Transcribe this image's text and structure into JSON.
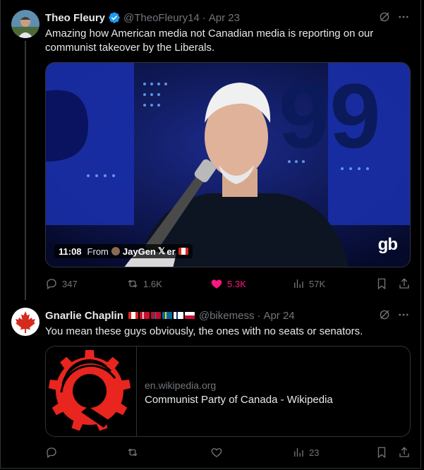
{
  "tweets": [
    {
      "author_name": "Theo Fleury",
      "verified": true,
      "handle": "@TheoFleury14",
      "separator": "·",
      "date": "Apr 23",
      "text_line1": "Amazing how American media not Canadian media  is reporting on our",
      "text_line2": "communist takeover by the Liberals.",
      "video": {
        "duration": "11:08",
        "from_label": "From",
        "source_name": "JayGen",
        "source_suffix": "er",
        "watermark": "gb"
      },
      "actions": {
        "replies": "347",
        "reposts": "1.6K",
        "likes": "5.3K",
        "views": "57K"
      },
      "like_color": "#f91880"
    },
    {
      "author_name": "Gnarlie Chaplin",
      "handle": "@bikemess",
      "separator": "·",
      "date": "Apr 24",
      "flags": [
        "canada",
        "denmark",
        "norway",
        "sweden",
        "finland",
        "greenland"
      ],
      "text": "You mean these guys obviously, the ones with no seats or senators.",
      "link_card": {
        "domain": "en.wikipedia.org",
        "title": "Communist Party of Canada - Wikipedia"
      },
      "actions": {
        "replies": "",
        "reposts": "",
        "likes": "",
        "views": "23"
      }
    }
  ],
  "colors": {
    "background": "#000000",
    "text": "#e7e9ea",
    "muted": "#71767b",
    "verified": "#1d9bf0",
    "logo_red": "#e8251f"
  }
}
